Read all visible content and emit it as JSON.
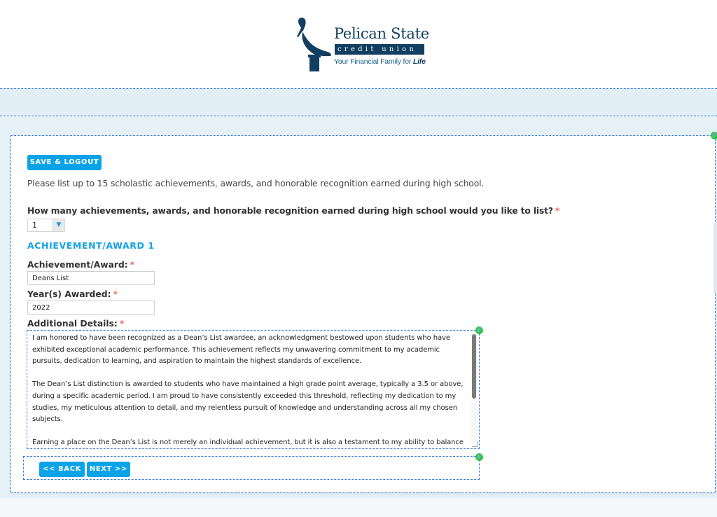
{
  "header": {
    "logo": {
      "brand": "Pelican State",
      "subbrand": "credit union",
      "tagline_prefix": "Your Financial Family for ",
      "tagline_emphasis": "Life",
      "icon": "pelican-logo-icon"
    }
  },
  "toolbar": {
    "save_logout_label": "SAVE & LOGOUT"
  },
  "form": {
    "intro_text": "Please list up to 15 scholastic achievements, awards, and honorable recognition earned during high school.",
    "count_question": "How many achievements, awards, and honorable recognition earned during high school would you like to list?",
    "required_marker": "*",
    "count_select": {
      "value": "1",
      "icon": "chevron-down-icon"
    },
    "section_title": "ACHIEVEMENT/AWARD 1",
    "fields": {
      "achievement_label": "Achievement/Award:",
      "achievement_value": "Deans List",
      "year_label": "Year(s) Awarded:",
      "year_value": "2022",
      "details_label": "Additional Details:",
      "details_value": "I am honored to have been recognized as a Dean’s List awardee, an acknowledgment bestowed upon students who have exhibited exceptional academic performance. This achievement reflects my unwavering commitment to my academic pursuits, dedication to learning, and aspiration to maintain the highest standards of excellence.\n\nThe Dean’s List distinction is awarded to students who have maintained a high grade point average, typically a 3.5 or above, during a specific academic period. I am proud to have consistently exceeded this threshold, reflecting my dedication to my studies, my meticulous attention to detail, and my relentless pursuit of knowledge and understanding across all my chosen subjects.\n\nEarning a place on the Dean’s List is not merely an individual achievement, but it is also a testament to my ability to balance competing priorities, manage time efficiently, and contribute positively to the learning environment. My approach to learning is"
    }
  },
  "navigation": {
    "back_label": "<< BACK",
    "next_label": "NEXT >>"
  },
  "colors": {
    "accent": "#0aa3e8",
    "brand_navy": "#123f61",
    "required": "#f06c6c",
    "edit_badge": "#28c840",
    "dashed_outline": "#3b7dd8"
  }
}
